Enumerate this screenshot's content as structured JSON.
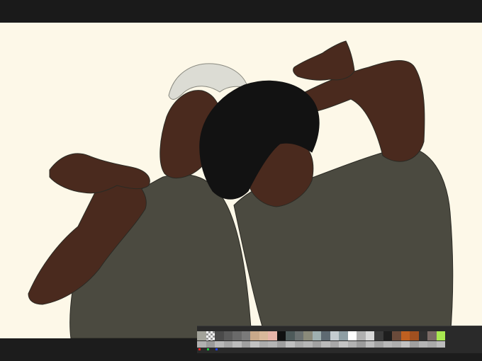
{
  "canvas": {
    "background_color": "#fdf8e8",
    "skin_color": "#4a2a1e",
    "shirt_color": "#4b4a40",
    "hair_dark_color": "#121212",
    "hair_light_color": "#dcdcd4",
    "line_color": "#2b2a24"
  },
  "palette": {
    "row1": [
      "#a3a39a",
      "transparent",
      "#4a4a4a",
      "#5a5a5a",
      "#6a6a6a",
      "#7a7a7a",
      "#c9a98a",
      "#d8b89a",
      "#e6b4a8",
      "#101010",
      "#4e5a5a",
      "#6a7070",
      "#8a8a7a",
      "#9fb0b0",
      "#5e6a72",
      "#c4ccd0",
      "#8e9ea4",
      "#ffffff",
      "#b0b0b0",
      "#d8d8d8",
      "#3a3a3a",
      "#1e1e1e",
      "#6a4a3a",
      "#c06020",
      "#a05020",
      "#303030",
      "#7a6a66",
      "#a8e850"
    ],
    "row2": [
      "#b0b0b0",
      "#9a9a9a",
      "#b8b8b8",
      "#a6a6a6",
      "#bcbcbc",
      "#a0a0a0",
      "#c2c2c2",
      "#acacac",
      "#b4b4b4",
      "#9e9e9e",
      "#c0c0c0",
      "#aaaaaa",
      "#b6b6b6",
      "#a2a2a2",
      "#bababa",
      "#a8a8a8",
      "#c4c4c4",
      "#b2b2b2",
      "#9c9c9c",
      "#bebebe",
      "#a4a4a4",
      "#b8b8b8",
      "#aeaeae",
      "#c2c2c2",
      "#a0a0a0",
      "#b4b4b4",
      "#aaaaaa",
      "#bcbcbc"
    ],
    "indicators": [
      "#e02020",
      "#20c040",
      "#2040e0"
    ]
  }
}
